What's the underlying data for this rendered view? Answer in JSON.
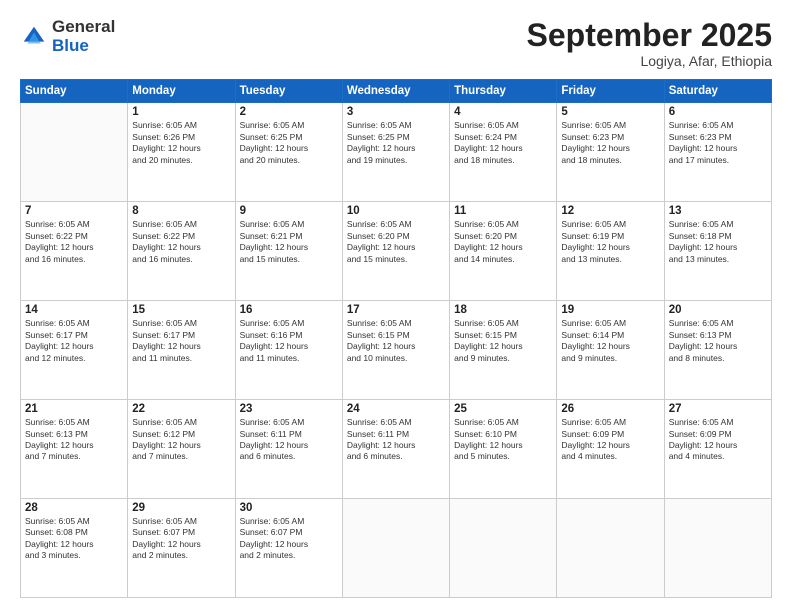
{
  "header": {
    "logo": {
      "line1": "General",
      "line2": "Blue"
    },
    "title": "September 2025",
    "subtitle": "Logiya, Afar, Ethiopia"
  },
  "days_of_week": [
    "Sunday",
    "Monday",
    "Tuesday",
    "Wednesday",
    "Thursday",
    "Friday",
    "Saturday"
  ],
  "weeks": [
    [
      {
        "day": "",
        "info": ""
      },
      {
        "day": "1",
        "info": "Sunrise: 6:05 AM\nSunset: 6:26 PM\nDaylight: 12 hours\nand 20 minutes."
      },
      {
        "day": "2",
        "info": "Sunrise: 6:05 AM\nSunset: 6:25 PM\nDaylight: 12 hours\nand 20 minutes."
      },
      {
        "day": "3",
        "info": "Sunrise: 6:05 AM\nSunset: 6:25 PM\nDaylight: 12 hours\nand 19 minutes."
      },
      {
        "day": "4",
        "info": "Sunrise: 6:05 AM\nSunset: 6:24 PM\nDaylight: 12 hours\nand 18 minutes."
      },
      {
        "day": "5",
        "info": "Sunrise: 6:05 AM\nSunset: 6:23 PM\nDaylight: 12 hours\nand 18 minutes."
      },
      {
        "day": "6",
        "info": "Sunrise: 6:05 AM\nSunset: 6:23 PM\nDaylight: 12 hours\nand 17 minutes."
      }
    ],
    [
      {
        "day": "7",
        "info": "Sunrise: 6:05 AM\nSunset: 6:22 PM\nDaylight: 12 hours\nand 16 minutes."
      },
      {
        "day": "8",
        "info": "Sunrise: 6:05 AM\nSunset: 6:22 PM\nDaylight: 12 hours\nand 16 minutes."
      },
      {
        "day": "9",
        "info": "Sunrise: 6:05 AM\nSunset: 6:21 PM\nDaylight: 12 hours\nand 15 minutes."
      },
      {
        "day": "10",
        "info": "Sunrise: 6:05 AM\nSunset: 6:20 PM\nDaylight: 12 hours\nand 15 minutes."
      },
      {
        "day": "11",
        "info": "Sunrise: 6:05 AM\nSunset: 6:20 PM\nDaylight: 12 hours\nand 14 minutes."
      },
      {
        "day": "12",
        "info": "Sunrise: 6:05 AM\nSunset: 6:19 PM\nDaylight: 12 hours\nand 13 minutes."
      },
      {
        "day": "13",
        "info": "Sunrise: 6:05 AM\nSunset: 6:18 PM\nDaylight: 12 hours\nand 13 minutes."
      }
    ],
    [
      {
        "day": "14",
        "info": "Sunrise: 6:05 AM\nSunset: 6:17 PM\nDaylight: 12 hours\nand 12 minutes."
      },
      {
        "day": "15",
        "info": "Sunrise: 6:05 AM\nSunset: 6:17 PM\nDaylight: 12 hours\nand 11 minutes."
      },
      {
        "day": "16",
        "info": "Sunrise: 6:05 AM\nSunset: 6:16 PM\nDaylight: 12 hours\nand 11 minutes."
      },
      {
        "day": "17",
        "info": "Sunrise: 6:05 AM\nSunset: 6:15 PM\nDaylight: 12 hours\nand 10 minutes."
      },
      {
        "day": "18",
        "info": "Sunrise: 6:05 AM\nSunset: 6:15 PM\nDaylight: 12 hours\nand 9 minutes."
      },
      {
        "day": "19",
        "info": "Sunrise: 6:05 AM\nSunset: 6:14 PM\nDaylight: 12 hours\nand 9 minutes."
      },
      {
        "day": "20",
        "info": "Sunrise: 6:05 AM\nSunset: 6:13 PM\nDaylight: 12 hours\nand 8 minutes."
      }
    ],
    [
      {
        "day": "21",
        "info": "Sunrise: 6:05 AM\nSunset: 6:13 PM\nDaylight: 12 hours\nand 7 minutes."
      },
      {
        "day": "22",
        "info": "Sunrise: 6:05 AM\nSunset: 6:12 PM\nDaylight: 12 hours\nand 7 minutes."
      },
      {
        "day": "23",
        "info": "Sunrise: 6:05 AM\nSunset: 6:11 PM\nDaylight: 12 hours\nand 6 minutes."
      },
      {
        "day": "24",
        "info": "Sunrise: 6:05 AM\nSunset: 6:11 PM\nDaylight: 12 hours\nand 6 minutes."
      },
      {
        "day": "25",
        "info": "Sunrise: 6:05 AM\nSunset: 6:10 PM\nDaylight: 12 hours\nand 5 minutes."
      },
      {
        "day": "26",
        "info": "Sunrise: 6:05 AM\nSunset: 6:09 PM\nDaylight: 12 hours\nand 4 minutes."
      },
      {
        "day": "27",
        "info": "Sunrise: 6:05 AM\nSunset: 6:09 PM\nDaylight: 12 hours\nand 4 minutes."
      }
    ],
    [
      {
        "day": "28",
        "info": "Sunrise: 6:05 AM\nSunset: 6:08 PM\nDaylight: 12 hours\nand 3 minutes."
      },
      {
        "day": "29",
        "info": "Sunrise: 6:05 AM\nSunset: 6:07 PM\nDaylight: 12 hours\nand 2 minutes."
      },
      {
        "day": "30",
        "info": "Sunrise: 6:05 AM\nSunset: 6:07 PM\nDaylight: 12 hours\nand 2 minutes."
      },
      {
        "day": "",
        "info": ""
      },
      {
        "day": "",
        "info": ""
      },
      {
        "day": "",
        "info": ""
      },
      {
        "day": "",
        "info": ""
      }
    ]
  ]
}
